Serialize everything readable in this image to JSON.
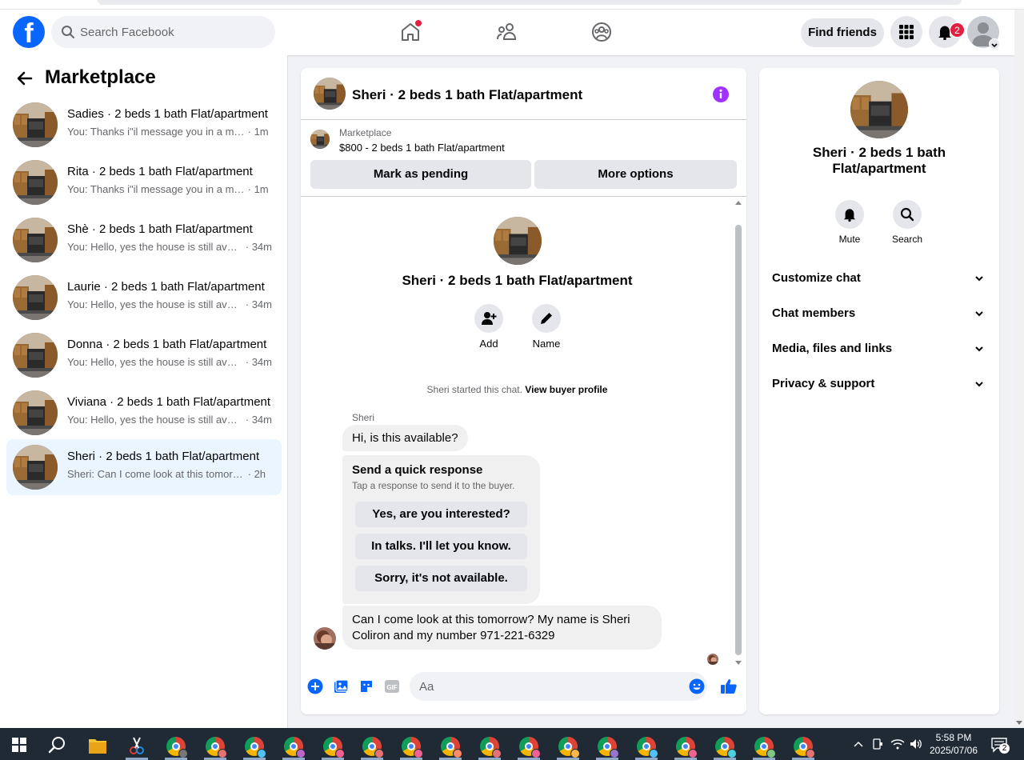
{
  "topbar": {
    "logo": "f",
    "search_placeholder": "Search Facebook",
    "find_friends": "Find friends",
    "notification_count": "2"
  },
  "sidebar": {
    "title": "Marketplace",
    "conversations": [
      {
        "name": "Sadies · 2 beds 1 bath Flat/apartment",
        "snippet": "You: Thanks i\"il message you in a moment.",
        "time": "· 1m"
      },
      {
        "name": "Rita · 2 beds 1 bath Flat/apartment",
        "snippet": "You: Thanks i\"il message you in a moment.",
        "time": "· 1m"
      },
      {
        "name": "Shè · 2 beds 1 bath Flat/apartment",
        "snippet": "You: Hello, yes the house is still available.",
        "time": "· 34m"
      },
      {
        "name": "Laurie · 2 beds 1 bath Flat/apartment",
        "snippet": "You: Hello, yes the house is still available.",
        "time": "· 34m"
      },
      {
        "name": "Donna · 2 beds 1 bath Flat/apartment",
        "snippet": "You: Hello, yes the house is still available.",
        "time": "· 34m"
      },
      {
        "name": "Viviana · 2 beds 1 bath Flat/apartment",
        "snippet": "You: Hello, yes the house is still available.",
        "time": "· 34m"
      },
      {
        "name": "Sheri · 2 beds 1 bath Flat/apartment",
        "snippet": "Sheri: Can I come look at this tomorrow?",
        "time": "· 2h"
      }
    ]
  },
  "chat": {
    "title": "Sheri · 2 beds 1 bath Flat/apartment",
    "listing_source": "Marketplace",
    "listing_price": "$800 - 2 beds 1 bath Flat/apartment",
    "mark_pending": "Mark as pending",
    "more_options": "More options",
    "center_title": "Sheri · 2 beds 1 bath Flat/apartment",
    "add_label": "Add",
    "name_label": "Name",
    "started_text": "Sheri started this chat.",
    "view_profile": "View buyer profile",
    "sender": "Sheri",
    "msg1": "Hi, is this available?",
    "quick_title": "Send a quick response",
    "quick_sub": "Tap a response to send it to the buyer.",
    "quick_options": [
      "Yes, are you interested?",
      "In talks. I'll let you know.",
      "Sorry, it's not available."
    ],
    "msg2_line1": "Can I come look at this tomorrow? My name is Sheri",
    "msg2_line2": "Coliron and my number 971-221-6329",
    "composer_placeholder": "Aa",
    "gif_label": "GIF"
  },
  "info": {
    "title_line1": "Sheri · 2 beds 1 bath",
    "title_line2": "Flat/apartment",
    "mute": "Mute",
    "search": "Search",
    "sections": [
      "Customize chat",
      "Chat members",
      "Media, files and links",
      "Privacy & support"
    ]
  },
  "taskbar": {
    "time": "5:58 PM",
    "date": "2025/07/06",
    "notif_count": "2"
  },
  "colors": {
    "fb_blue": "#0866ff",
    "messenger_purple": "#a033ff",
    "badge_red": "#e41e3f",
    "active_bg": "#ebf5ff"
  }
}
